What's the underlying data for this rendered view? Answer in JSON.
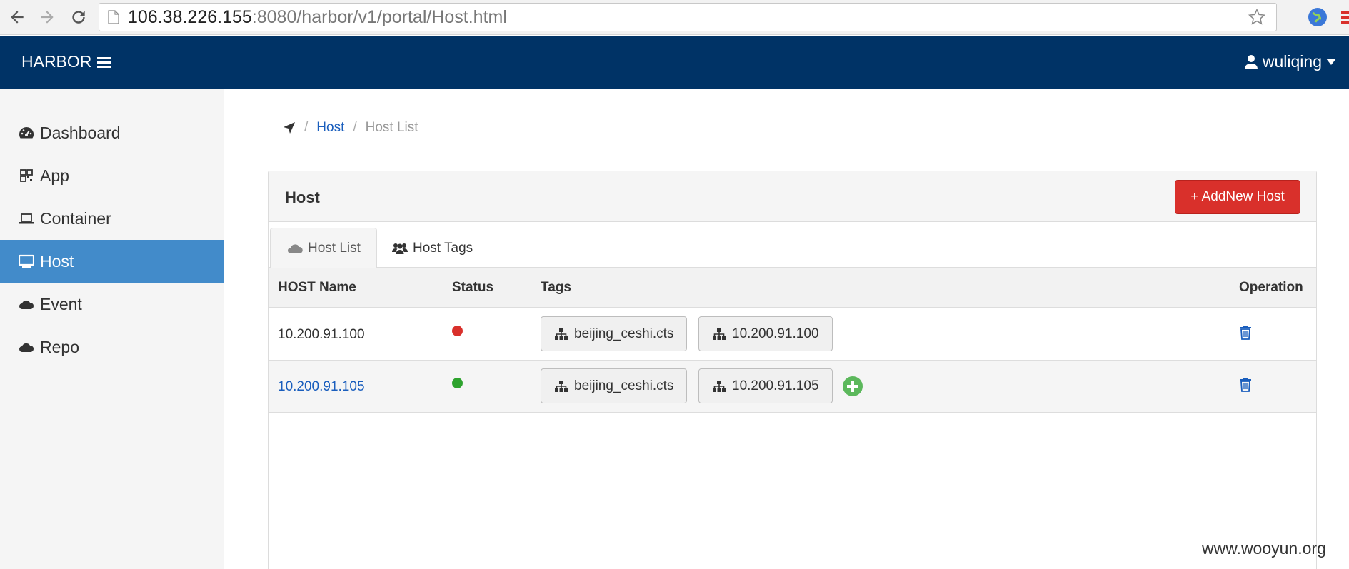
{
  "browser": {
    "url_host": "106.38.226.155",
    "url_rest": ":8080/harbor/v1/portal/Host.html"
  },
  "header": {
    "brand": "HARBOR",
    "user": "wuliqing"
  },
  "sidebar": {
    "items": [
      {
        "label": "Dashboard",
        "icon": "dashboard-icon"
      },
      {
        "label": "App",
        "icon": "qrcode-icon"
      },
      {
        "label": "Container",
        "icon": "laptop-icon"
      },
      {
        "label": "Host",
        "icon": "desktop-icon",
        "active": true
      },
      {
        "label": "Event",
        "icon": "cloud-icon"
      },
      {
        "label": "Repo",
        "icon": "cloud-icon"
      }
    ]
  },
  "breadcrumb": {
    "link": "Host",
    "current": "Host List"
  },
  "panel": {
    "title": "Host",
    "add_button": "+ AddNew Host",
    "tabs": [
      {
        "label": "Host List",
        "icon": "cloud-icon",
        "active": true
      },
      {
        "label": "Host Tags",
        "icon": "users-icon"
      }
    ],
    "columns": [
      "HOST Name",
      "Status",
      "Tags",
      "Operation"
    ],
    "rows": [
      {
        "name": "10.200.91.100",
        "status_color": "#d9302b",
        "tags": [
          "beijing_ceshi.cts",
          "10.200.91.100"
        ],
        "linked": false
      },
      {
        "name": "10.200.91.105",
        "status_color": "#2ea32e",
        "tags": [
          "beijing_ceshi.cts",
          "10.200.91.105"
        ],
        "linked": true
      }
    ]
  },
  "watermark": "www.wooyun.org",
  "colors": {
    "header": "#003366",
    "active": "#428bca",
    "danger": "#d9302b",
    "success": "#5cb85c",
    "link": "#1a5ebd"
  }
}
